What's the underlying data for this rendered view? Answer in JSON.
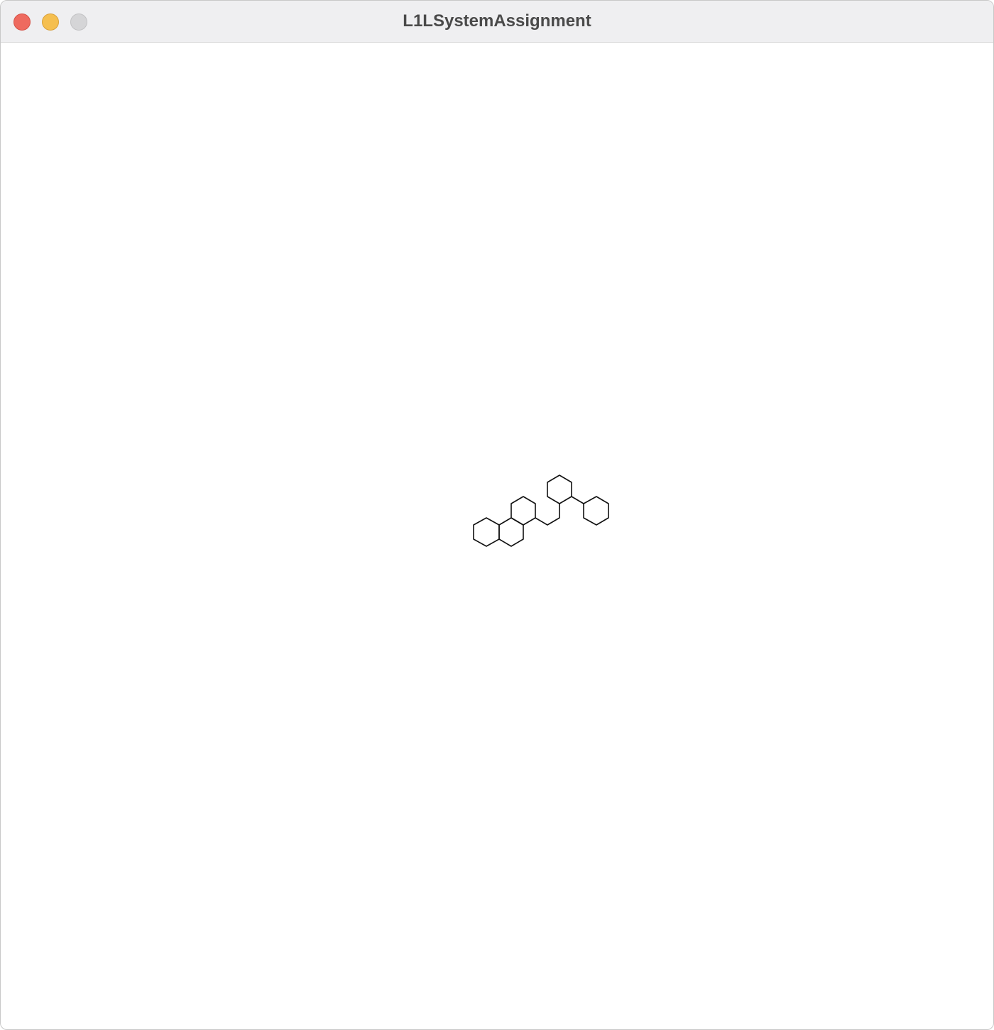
{
  "window": {
    "title": "L1LSystemAssignment"
  }
}
